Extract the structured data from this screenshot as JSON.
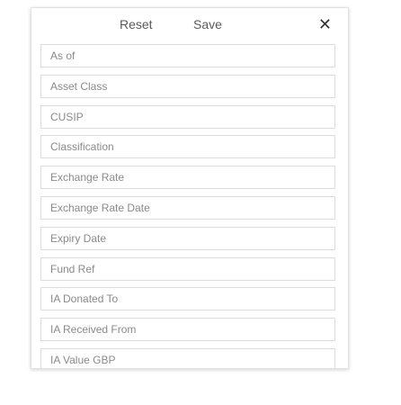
{
  "header": {
    "reset_label": "Reset",
    "save_label": "Save",
    "close_icon": "close-icon",
    "close_glyph": "✕"
  },
  "fields": [
    "As of",
    "Asset Class",
    "CUSIP",
    "Classification",
    "Exchange Rate",
    "Exchange Rate Date",
    "Expiry Date",
    "Fund Ref",
    "IA Donated To",
    "IA Received From",
    "IA Value GBP"
  ]
}
